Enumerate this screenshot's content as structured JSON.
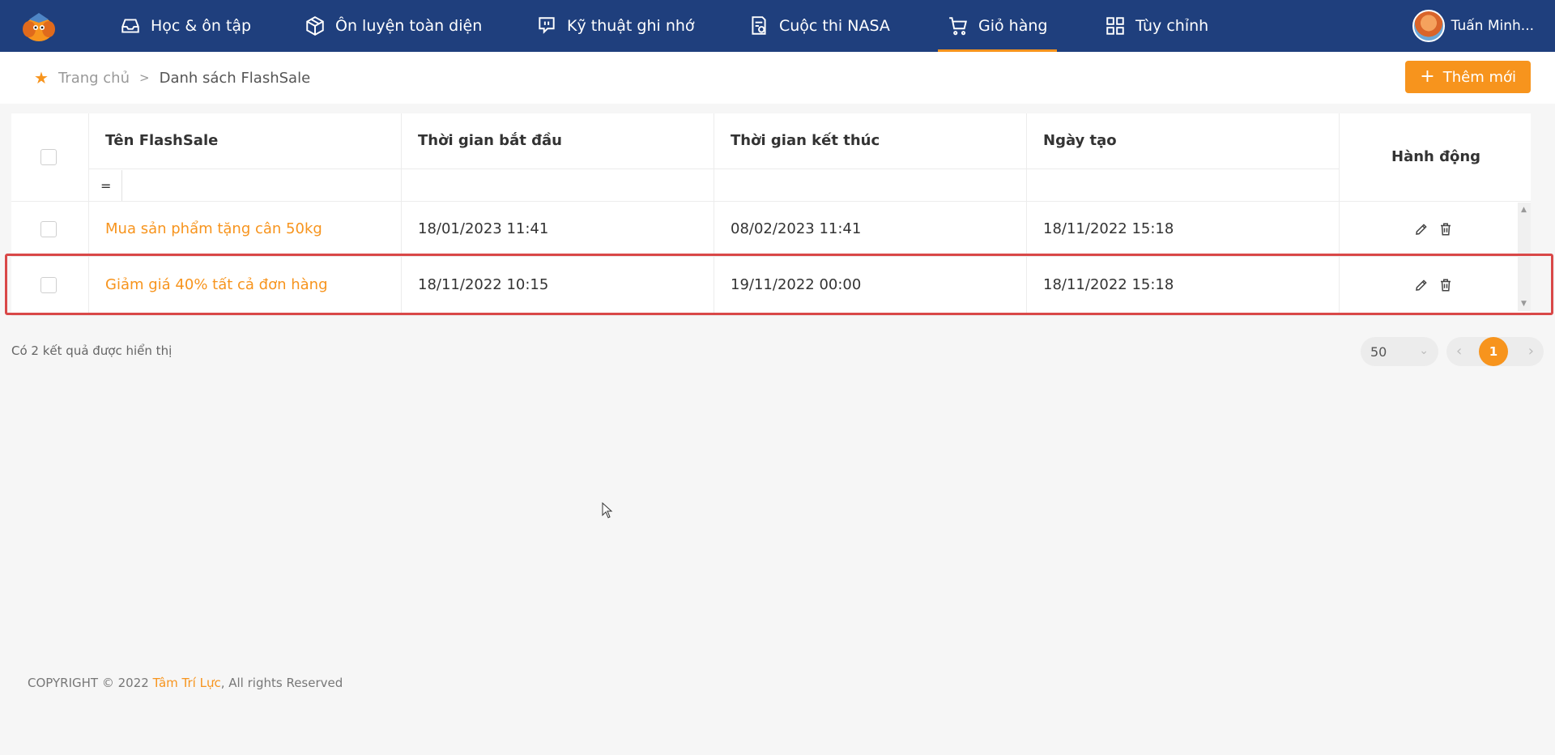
{
  "nav": {
    "items": [
      {
        "label": "Học & ôn tập",
        "icon": "inbox-icon"
      },
      {
        "label": "Ôn luyện toàn diện",
        "icon": "cube-icon"
      },
      {
        "label": "Kỹ thuật ghi nhớ",
        "icon": "chat-icon"
      },
      {
        "label": "Cuộc thi NASA",
        "icon": "document-icon"
      },
      {
        "label": "Giỏ hàng",
        "icon": "cart-icon",
        "active": true
      },
      {
        "label": "Tùy chỉnh",
        "icon": "grid-icon"
      }
    ],
    "user_name": "Tuấn Minh..."
  },
  "breadcrumb": {
    "home": "Trang chủ",
    "separator": ">",
    "current": "Danh sách FlashSale"
  },
  "toolbar": {
    "add_label": "Thêm mới",
    "add_icon": "plus-icon"
  },
  "table": {
    "headers": {
      "name": "Tên FlashSale",
      "start": "Thời gian bắt đầu",
      "end": "Thời gian kết thúc",
      "created": "Ngày tạo",
      "actions": "Hành động"
    },
    "filter_operator": "=",
    "rows": [
      {
        "name": "Mua sản phẩm tặng cân 50kg",
        "start": "18/01/2023 11:41",
        "end": "08/02/2023 11:41",
        "created": "18/11/2022 15:18"
      },
      {
        "name": "Giảm giá 40% tất cả đơn hàng",
        "start": "18/11/2022 10:15",
        "end": "19/11/2022 00:00",
        "created": "18/11/2022 15:18"
      }
    ]
  },
  "footer": {
    "result_text": "Có 2 kết quả được hiển thị",
    "page_size": "50",
    "current_page": "1"
  },
  "copyright": {
    "prefix": "COPYRIGHT © 2022 ",
    "brand": "Tâm Trí Lực",
    "suffix": ", All rights Reserved"
  },
  "colors": {
    "nav_bg": "#1f3f7d",
    "accent": "#f7941d",
    "highlight": "#d94848"
  }
}
